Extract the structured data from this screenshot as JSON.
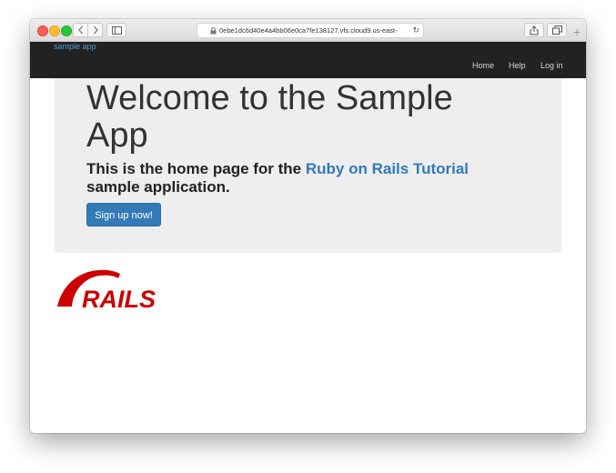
{
  "browser": {
    "url": "0ebe1dc6d40e4a4bb06e0ca7fe138127.vfs.cloud9.us-east-",
    "plus_label": "+"
  },
  "navbar": {
    "brand": "sample app",
    "links": [
      "Home",
      "Help",
      "Log in"
    ]
  },
  "hero": {
    "title": "Welcome to the Sample App",
    "subtitle_before": "This is the home page for the ",
    "subtitle_link": "Ruby on Rails Tutorial",
    "subtitle_after": " sample application.",
    "button_label": "Sign up now!"
  },
  "logo": {
    "text": "RAILS",
    "color": "#cc0000"
  },
  "colors": {
    "navbar_bg": "#222222",
    "brand_link": "#4f9ad3",
    "primary": "#337ab7",
    "jumbotron_bg": "#eeeeee"
  }
}
